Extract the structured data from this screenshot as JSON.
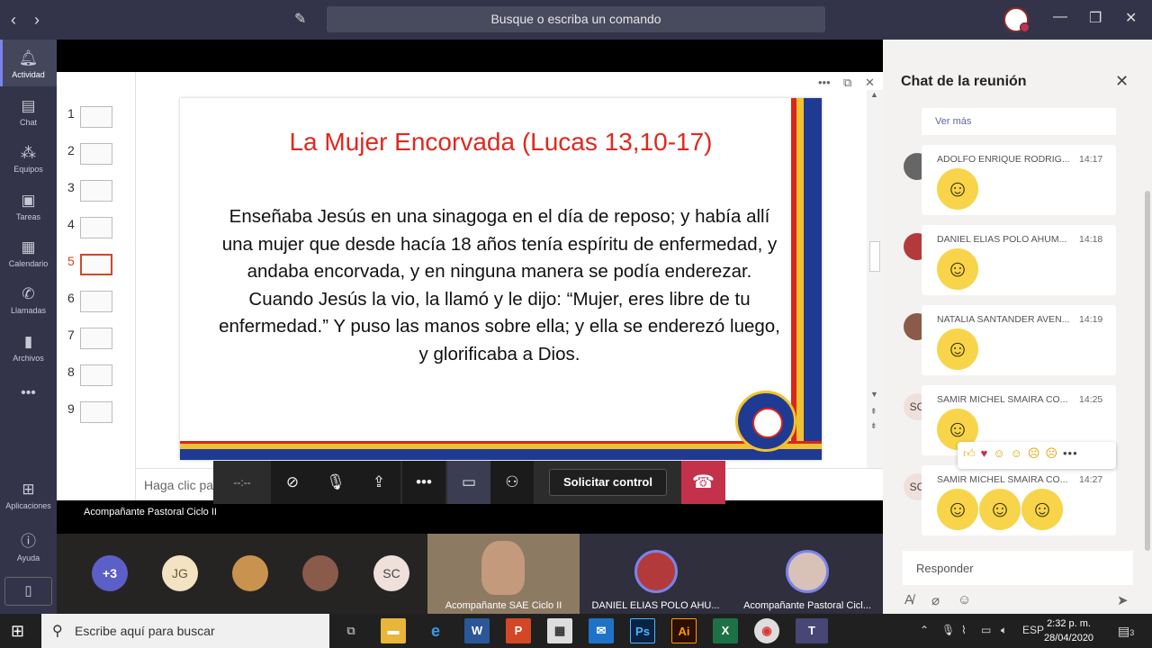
{
  "titlebar": {
    "search_placeholder": "Busque o escriba un comando"
  },
  "rail": [
    {
      "label": "Actividad",
      "icon": "bell-icon"
    },
    {
      "label": "Chat",
      "icon": "chat-icon"
    },
    {
      "label": "Equipos",
      "icon": "teams-icon"
    },
    {
      "label": "Tareas",
      "icon": "assignments-icon"
    },
    {
      "label": "Calendario",
      "icon": "calendar-icon"
    },
    {
      "label": "Llamadas",
      "icon": "phone-icon"
    },
    {
      "label": "Archivos",
      "icon": "files-icon"
    },
    {
      "label": "Aplicaciones",
      "icon": "apps-icon"
    },
    {
      "label": "Ayuda",
      "icon": "help-icon"
    }
  ],
  "presentation": {
    "thumbnails": [
      "1",
      "2",
      "3",
      "4",
      "5",
      "6",
      "7",
      "8",
      "9"
    ],
    "selected": "5",
    "slide_title": "La Mujer Encorvada (Lucas 13,10-17)",
    "slide_body_lines": [
      "Enseñaba Jesús en una sinagoga en el día de reposo; y había allí",
      "una mujer que desde hacía 18 años tenía espíritu de enfermedad, y",
      "andaba encorvada, y en ninguna manera se podía enderezar.",
      "Cuando Jesús la vio, la llamó y le dijo: “Mujer, eres libre de tu",
      "enfermedad.” Y puso las manos sobre ella; y ella se enderezó luego,",
      "y glorificaba a Dios."
    ],
    "notes_placeholder": "Haga clic para agregar notas"
  },
  "callbar": {
    "timer": "--:--",
    "request_control": "Solicitar control"
  },
  "presenter_caption": "Acompañante Pastoral Ciclo II",
  "participants": {
    "overflow": "+3",
    "initials": [
      "JG",
      "SC"
    ],
    "tiles": [
      {
        "name": "Acompañante SAE Ciclo II"
      },
      {
        "name": "DANIEL ELIAS POLO AHU..."
      },
      {
        "name": "Acompañante Pastoral Cicl..."
      }
    ]
  },
  "chat": {
    "title": "Chat de la reunión",
    "see_more": "Ver más",
    "messages": [
      {
        "author": "ADOLFO ENRIQUE RODRIG...",
        "time": "14:17"
      },
      {
        "author": "DANIEL ELIAS POLO AHUM...",
        "time": "14:18"
      },
      {
        "author": "NATALIA SANTANDER AVEN...",
        "time": "14:19"
      },
      {
        "author": "SAMIR MICHEL SMAIRA CO...",
        "time": "14:25",
        "initials": "SC"
      },
      {
        "author": "SAMIR MICHEL SMAIRA CO...",
        "time": "14:27",
        "initials": "SC"
      }
    ],
    "reply_placeholder": "Responder"
  },
  "taskbar": {
    "search_placeholder": "Escribe aquí para buscar",
    "language": "ESP",
    "time": "2:32 p. m.",
    "date": "28/04/2020",
    "notifications": "3"
  },
  "colors": {
    "teams_purple": "#6264a7",
    "hangup_red": "#c4314b",
    "slide_title_red": "#e0281f"
  }
}
